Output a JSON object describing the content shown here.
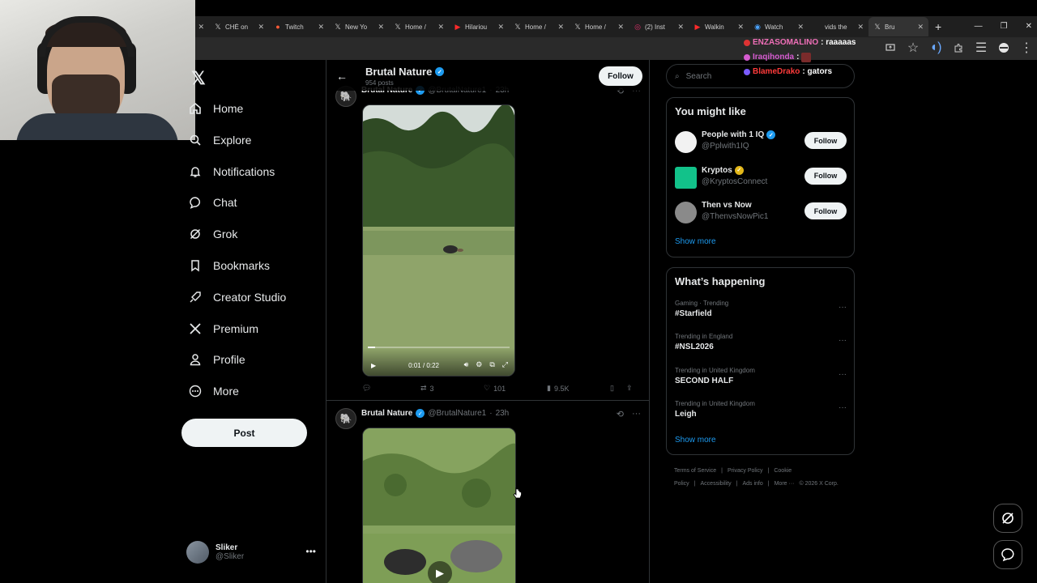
{
  "browser": {
    "tabs": [
      {
        "label": "",
        "icon": ""
      },
      {
        "label": "CHÉ on",
        "icon": "x-logo-icon"
      },
      {
        "label": "Twitch",
        "icon": "twitch-icon"
      },
      {
        "label": "New Yo",
        "icon": "x-logo-icon"
      },
      {
        "label": "Home /",
        "icon": "x-logo-icon"
      },
      {
        "label": "Hilariou",
        "icon": "youtube-icon"
      },
      {
        "label": "Home /",
        "icon": "x-logo-icon"
      },
      {
        "label": "Home /",
        "icon": "x-logo-icon"
      },
      {
        "label": "(2) Inst",
        "icon": "instagram-icon"
      },
      {
        "label": "Walkin",
        "icon": "youtube-icon"
      },
      {
        "label": "Watch",
        "icon": "watch-icon"
      },
      {
        "label": "vids the",
        "icon": ""
      },
      {
        "label": "Bru",
        "icon": "x-logo-icon",
        "active": true
      }
    ]
  },
  "chat": [
    {
      "user": "ENZASOMALINO",
      "user_color": "#f06fb8",
      "msg": ": raaaaas"
    },
    {
      "user": "Iraqihonda",
      "user_color": "#d65cd0",
      "msg": ":"
    },
    {
      "user": "BlameDrako",
      "user_color": "#ff3b3b",
      "msg": ": gators"
    }
  ],
  "nav": {
    "items": [
      {
        "label": "Home",
        "icon": "home-icon"
      },
      {
        "label": "Explore",
        "icon": "search-icon"
      },
      {
        "label": "Notifications",
        "icon": "bell-icon"
      },
      {
        "label": "Chat",
        "icon": "chat-icon"
      },
      {
        "label": "Grok",
        "icon": "grok-icon"
      },
      {
        "label": "Bookmarks",
        "icon": "bookmark-icon"
      },
      {
        "label": "Creator Studio",
        "icon": "rocket-icon"
      },
      {
        "label": "Premium",
        "icon": "x-logo-icon"
      },
      {
        "label": "Profile",
        "icon": "person-icon"
      },
      {
        "label": "More",
        "icon": "more-icon"
      }
    ],
    "post_label": "Post",
    "account": {
      "name": "Sliker",
      "handle": "@Sliker"
    }
  },
  "profile_header": {
    "name": "Brutal Nature",
    "posts": "954 posts",
    "follow_label": "Follow"
  },
  "tweets": [
    {
      "name": "Brutal Nature",
      "handle": "@BrutalNature1",
      "time": "23h",
      "video_time": "0:01 / 0:22",
      "progress": 0.05,
      "replies": "",
      "reposts": "3",
      "likes": "101",
      "views": "9.5K"
    },
    {
      "name": "Brutal Nature",
      "handle": "@BrutalNature1",
      "time": "23h"
    }
  ],
  "right": {
    "search_placeholder": "Search",
    "you_might_like": {
      "title": "You might like",
      "accounts": [
        {
          "name": "People with 1 IQ",
          "handle": "@Pplwith1IQ",
          "badge": "blue",
          "follow": "Follow"
        },
        {
          "name": "Kryptos",
          "handle": "@KryptosConnect",
          "badge": "gold",
          "follow": "Follow"
        },
        {
          "name": "Then vs Now",
          "handle": "@ThenvsNowPic1",
          "badge": "",
          "follow": "Follow"
        }
      ],
      "show_more": "Show more"
    },
    "whats_happening": {
      "title": "What’s happening",
      "trends": [
        {
          "context": "Gaming · Trending",
          "title": "#Starfield"
        },
        {
          "context": "Trending in England",
          "title": "#NSL2026"
        },
        {
          "context": "Trending in United Kingdom",
          "title": "SECOND HALF"
        },
        {
          "context": "Trending in United Kingdom",
          "title": "Leigh"
        }
      ],
      "show_more": "Show more"
    },
    "footer": [
      "Terms of Service",
      "|",
      "Privacy Policy",
      "|",
      "Cookie Policy",
      "|",
      "Accessibility",
      "|",
      "Ads info",
      "|",
      "More ···",
      "© 2026 X Corp."
    ]
  }
}
